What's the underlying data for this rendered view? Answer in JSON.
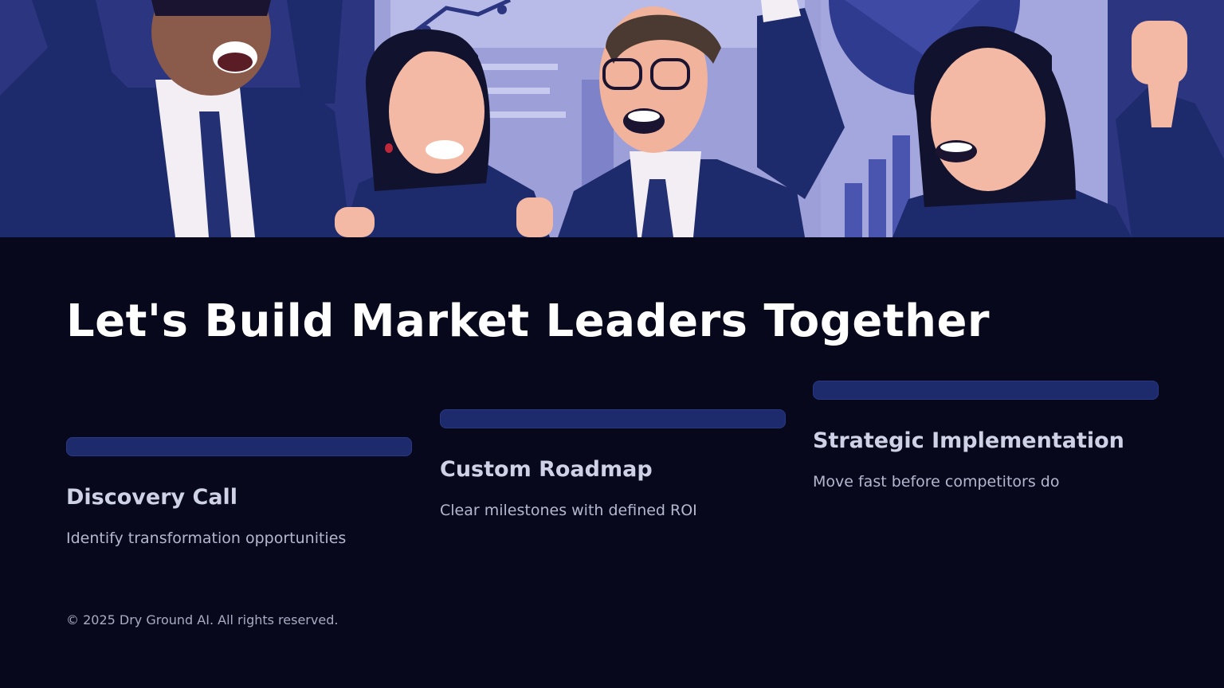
{
  "hero": {
    "illustration": "team-celebrating-illustration",
    "palette": {
      "background": "#2b3580",
      "light": "#b3b6e4",
      "suit": "#1d2a6b",
      "skin": "#f4b9a4"
    }
  },
  "title": "Let's Build Market Leaders Together",
  "steps": [
    {
      "title": "Discovery Call",
      "description": "Identify transformation opportunities"
    },
    {
      "title": "Custom Roadmap",
      "description": "Clear milestones with defined ROI"
    },
    {
      "title": "Strategic Implementation",
      "description": "Move fast before competitors do"
    }
  ],
  "footer": {
    "copyright": "© 2025 Dry Ground AI. All rights reserved."
  },
  "colors": {
    "page_background": "#07081c",
    "title_text": "#ffffff",
    "step_bar": "#1d2a6b",
    "step_title": "#cfd2e6",
    "step_description": "#b4b7cf",
    "footer_text": "#a9abc2"
  }
}
